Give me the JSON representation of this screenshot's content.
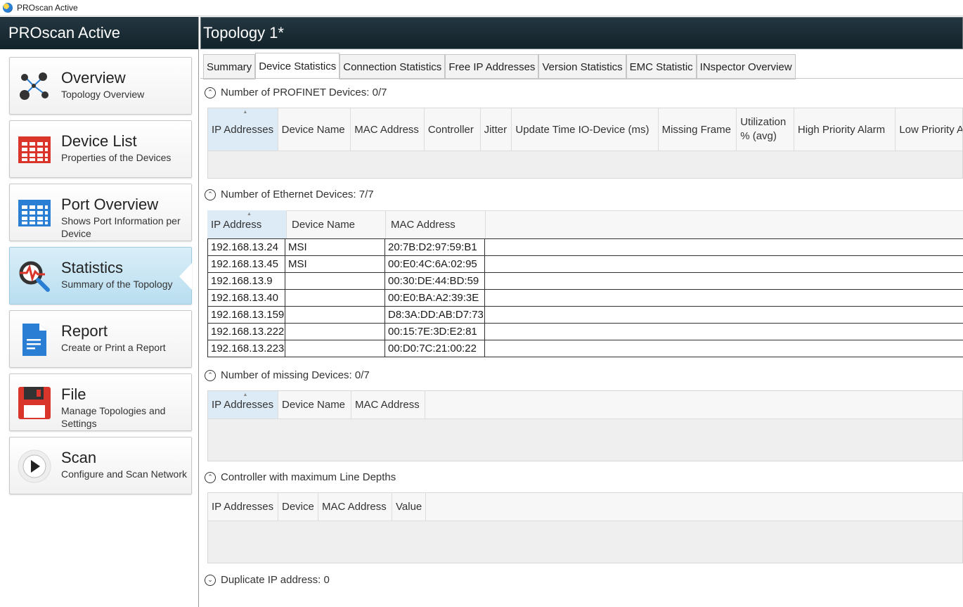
{
  "window": {
    "title": "PROscan Active"
  },
  "sidebar": {
    "header": "PROscan Active",
    "items": [
      {
        "title": "Overview",
        "subtitle": "Topology Overview"
      },
      {
        "title": "Device List",
        "subtitle": "Properties of the Devices"
      },
      {
        "title": "Port Overview",
        "subtitle": "Shows Port Information per Device"
      },
      {
        "title": "Statistics",
        "subtitle": "Summary of the Topology"
      },
      {
        "title": "Report",
        "subtitle": "Create or Print a Report"
      },
      {
        "title": "File",
        "subtitle": "Manage Topologies and Settings"
      },
      {
        "title": "Scan",
        "subtitle": "Configure and Scan Network"
      }
    ]
  },
  "main": {
    "title": "Topology 1*",
    "tabs": [
      "Summary",
      "Device Statistics",
      "Connection Statistics",
      "Free IP Addresses",
      "Version Statistics",
      "EMC Statistic",
      "INspector Overview"
    ],
    "active_tab": "Device Statistics"
  },
  "profinet": {
    "title": "Number of PROFINET Devices: 0/7",
    "columns": [
      "IP Addresses",
      "Device Name",
      "MAC Address",
      "Controller",
      "Jitter",
      "Update Time IO-Device (ms)",
      "Missing Frame",
      "Utilization % (avg)",
      "High Priority Alarm",
      "Low Priority A"
    ]
  },
  "ethernet": {
    "title": "Number of Ethernet Devices: 7/7",
    "columns": [
      "IP Address",
      "Device Name",
      "MAC Address"
    ],
    "rows": [
      [
        "192.168.13.24",
        "MSI",
        "20:7B:D2:97:59:B1"
      ],
      [
        "192.168.13.45",
        "MSI",
        "00:E0:4C:6A:02:95"
      ],
      [
        "192.168.13.9",
        "",
        "00:30:DE:44:BD:59"
      ],
      [
        "192.168.13.40",
        "",
        "00:E0:BA:A2:39:3E"
      ],
      [
        "192.168.13.159",
        "",
        "D8:3A:DD:AB:D7:73"
      ],
      [
        "192.168.13.222",
        "",
        "00:15:7E:3D:E2:81"
      ],
      [
        "192.168.13.223",
        "",
        "00:D0:7C:21:00:22"
      ]
    ]
  },
  "missing": {
    "title": "Number of missing Devices: 0/7",
    "columns": [
      "IP Addresses",
      "Device Name",
      "MAC Address"
    ]
  },
  "controller": {
    "title": "Controller with maximum Line Depths",
    "columns": [
      "IP Addresses",
      "Device",
      "MAC Address",
      "Value"
    ]
  },
  "duplicate": {
    "title": "Duplicate IP address: 0"
  },
  "colors": {
    "header_bg": "#1a2c35",
    "active_item": "#c9e6f4",
    "statistics_red": "#d9352b",
    "accent_blue": "#2a7fd4"
  }
}
